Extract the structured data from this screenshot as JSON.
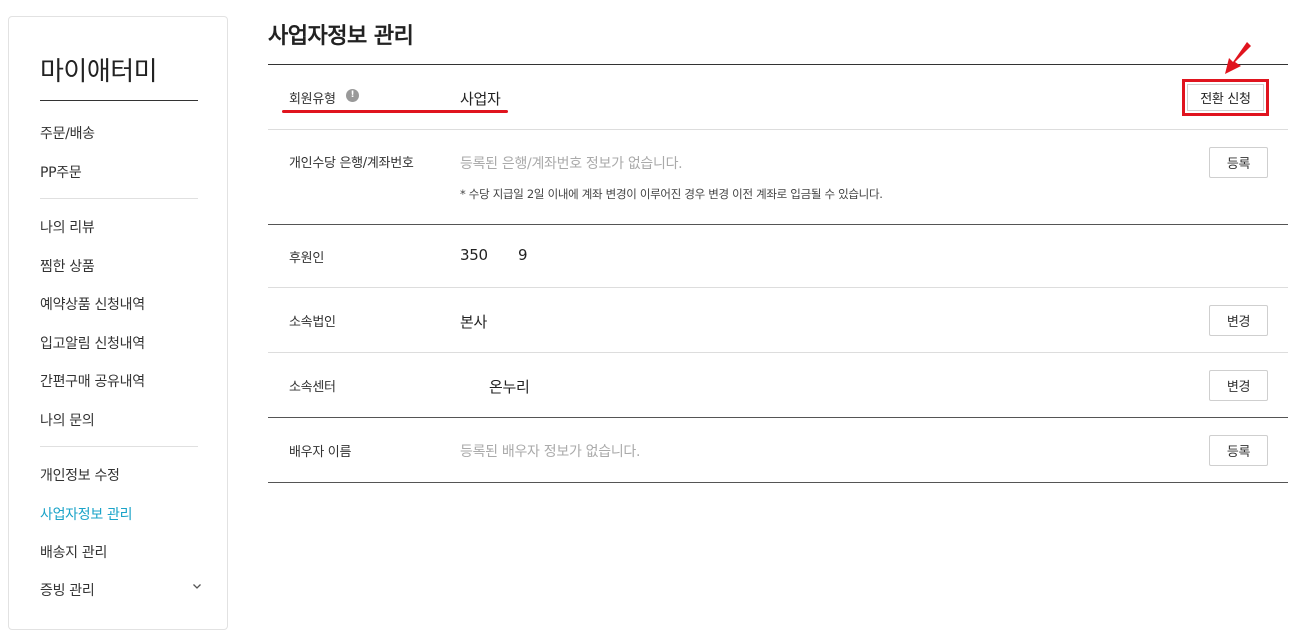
{
  "sidebar": {
    "title": "마이애터미",
    "items": [
      {
        "label": "주문/배송"
      },
      {
        "label": "PP주문"
      },
      {
        "label": "나의 리뷰"
      },
      {
        "label": "찜한 상품"
      },
      {
        "label": "예약상품 신청내역"
      },
      {
        "label": "입고알림 신청내역"
      },
      {
        "label": "간편구매 공유내역"
      },
      {
        "label": "나의 문의"
      },
      {
        "label": "개인정보 수정"
      },
      {
        "label": "사업자정보 관리"
      },
      {
        "label": "배송지 관리"
      },
      {
        "label": "증빙 관리"
      }
    ],
    "active": "사업자정보 관리"
  },
  "main": {
    "title": "사업자정보 관리",
    "rows": {
      "member_type": {
        "label": "회원유형",
        "value": "사업자",
        "button": "전환 신청"
      },
      "bank": {
        "label": "개인수당 은행/계좌번호",
        "placeholder": "등록된 은행/계좌번호 정보가 없습니다.",
        "note": "* 수당 지급일 2일 이내에 계좌 변경이 이루어진 경우 변경 이전 계좌로 입금될 수 있습니다.",
        "button": "등록"
      },
      "sponsor": {
        "label": "후원인",
        "value_a": "350",
        "value_b": "9"
      },
      "corporation": {
        "label": "소속법인",
        "value": "본사",
        "button": "변경"
      },
      "center": {
        "label": "소속센터",
        "value": "온누리",
        "button": "변경"
      },
      "spouse": {
        "label": "배우자 이름",
        "placeholder": "등록된 배우자 정보가 없습니다.",
        "button": "등록"
      }
    }
  },
  "colors": {
    "accent": "#1aa3c8",
    "highlight": "#e0141e"
  },
  "icons": {
    "info": "info-icon",
    "chevron": "chevron-down-icon",
    "arrow": "arrow-down-left-icon"
  }
}
